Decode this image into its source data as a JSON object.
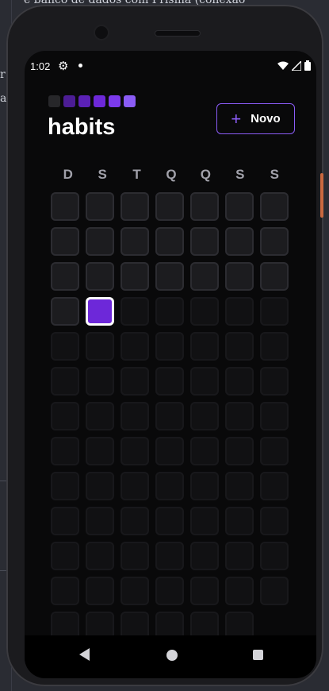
{
  "background": {
    "top_text": "e banco de dados com Prisma (conexão",
    "left_char_1": "r",
    "left_char_2": "a"
  },
  "status_bar": {
    "time": "1:02",
    "settings_icon": "gear-icon",
    "wifi_icon": "wifi-icon",
    "signal_icon": "signal-icon",
    "battery_icon": "battery-icon"
  },
  "header": {
    "app_title": "habits",
    "new_button_label": "Novo",
    "new_button_icon": "plus-icon",
    "logo_colors": [
      "#27272a",
      "#4c1d95",
      "#5b21b6",
      "#6d28d9",
      "#7c3aed",
      "#8b5cf6"
    ]
  },
  "weekdays": [
    "D",
    "S",
    "T",
    "Q",
    "Q",
    "S",
    "S"
  ],
  "calendar": {
    "today_index": 22,
    "past_count": 22,
    "total_cells": 90,
    "accent_color": "#6d28d9"
  },
  "nav_bar": {
    "back_icon": "back-triangle-icon",
    "home_icon": "home-circle-icon",
    "recents_icon": "recents-square-icon"
  }
}
